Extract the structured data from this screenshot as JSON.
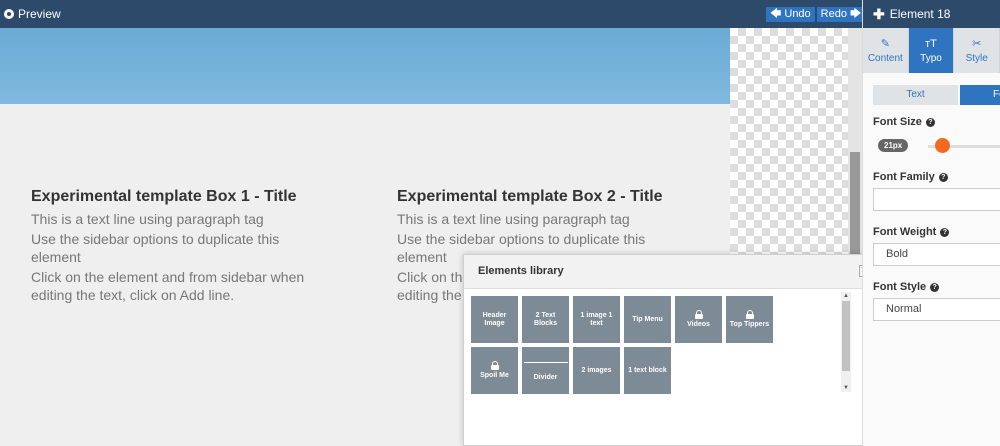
{
  "topbar": {
    "preview_label": "Preview",
    "undo_label": "Undo",
    "redo_label": "Redo"
  },
  "canvas": {
    "boxes": [
      {
        "title": "Experimental template Box 1 - Title",
        "lines": [
          "This is a text line using paragraph tag",
          "Use the sidebar options to duplicate this element",
          "Click on the element and from sidebar when editing the text, click on Add line."
        ]
      },
      {
        "title": "Experimental template Box 2 - Title",
        "lines": [
          "This is a text line using paragraph tag",
          "Use the sidebar options to duplicate this element",
          "Click on the element and from sidebar when editing the text, click on Add line."
        ]
      }
    ]
  },
  "library": {
    "title": "Elements library",
    "close_label": "✖",
    "items": [
      {
        "label": "Header Image",
        "locked": false,
        "icon": "none"
      },
      {
        "label": "2 Text Blocks",
        "locked": false,
        "icon": "none"
      },
      {
        "label": "1 image 1 text",
        "locked": false,
        "icon": "none"
      },
      {
        "label": "Tip Menu",
        "locked": false,
        "icon": "none"
      },
      {
        "label": "Videos",
        "locked": true,
        "icon": "lock-icon"
      },
      {
        "label": "Top Tippers",
        "locked": true,
        "icon": "lock-icon"
      },
      {
        "label": "Spoil Me",
        "locked": true,
        "icon": "lock-icon"
      },
      {
        "label": "Divider",
        "locked": false,
        "icon": "divider-line-icon"
      },
      {
        "label": "2 images",
        "locked": false,
        "icon": "none"
      },
      {
        "label": "1 text block",
        "locked": false,
        "icon": "none"
      }
    ]
  },
  "panel": {
    "title": "Element 18",
    "tabs": [
      {
        "label": "Content",
        "icon": "edit-icon",
        "active": false
      },
      {
        "label": "Typo",
        "icon": "typography-icon",
        "active": true
      },
      {
        "label": "Style",
        "icon": "style-icon",
        "active": false
      }
    ],
    "subtabs": {
      "text": "Text",
      "font": "Fo"
    },
    "font_size": {
      "label": "Font Size",
      "value": "21px"
    },
    "font_family": {
      "label": "Font Family",
      "value": ""
    },
    "font_weight": {
      "label": "Font Weight",
      "value": "Bold"
    },
    "font_style": {
      "label": "Font Style",
      "value": "Normal"
    }
  },
  "colors": {
    "topbar_bg": "#2d4a6b",
    "accent_blue": "#2f74c0",
    "slider_knob": "#f26a21",
    "tile_bg": "#7c8b96"
  }
}
